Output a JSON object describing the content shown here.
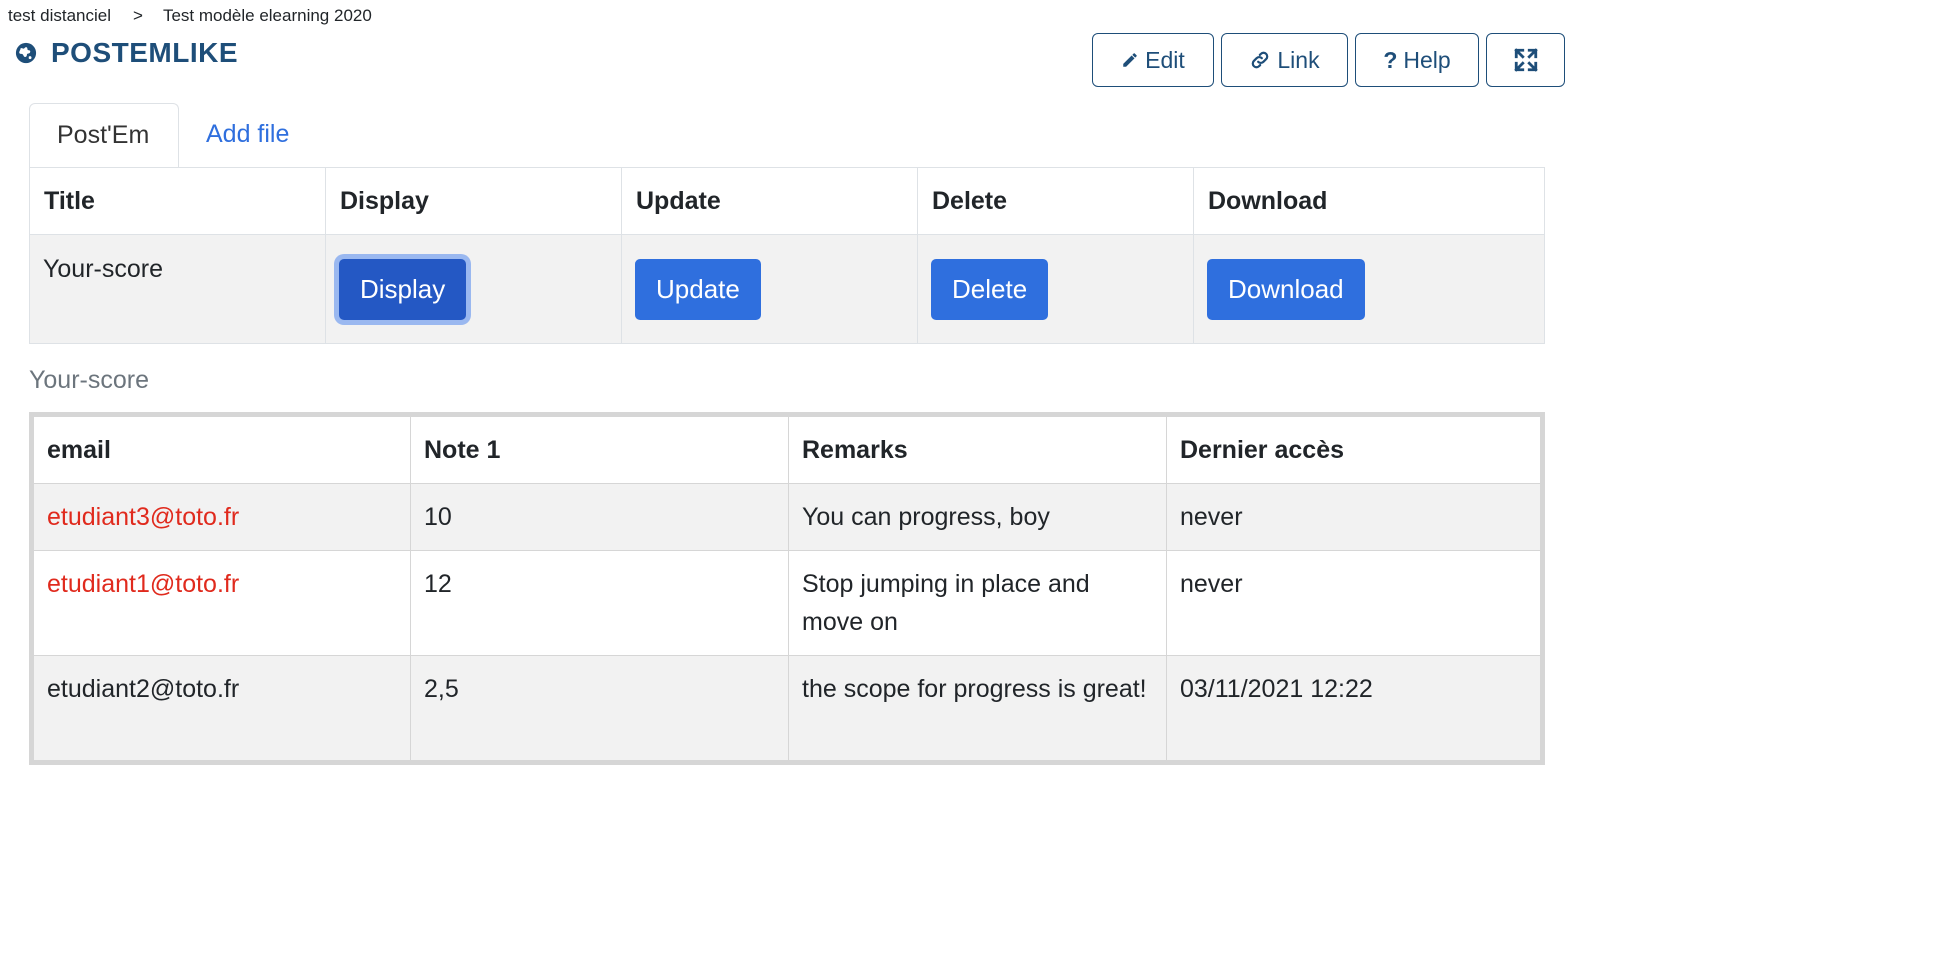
{
  "breadcrumb": {
    "items": [
      "test distanciel",
      "Test modèle elearning 2020"
    ],
    "separator": ">"
  },
  "header": {
    "title": "POSTEMLIKE",
    "icon": "globe-icon",
    "title_color": "#1e4e79"
  },
  "toolbar": {
    "edit_label": "Edit",
    "link_label": "Link",
    "help_label": "Help",
    "icons": [
      "pencil-icon",
      "link-icon",
      "question-icon",
      "expand-icon"
    ]
  },
  "tabs": [
    {
      "label": "Post'Em",
      "active": true
    },
    {
      "label": "Add file",
      "active": false
    }
  ],
  "files_table": {
    "headers": [
      "Title",
      "Display",
      "Update",
      "Delete",
      "Download"
    ],
    "rows": [
      {
        "title": "Your-score",
        "display_label": "Display",
        "update_label": "Update",
        "delete_label": "Delete",
        "download_label": "Download"
      }
    ]
  },
  "score_section": {
    "title": "Your-score",
    "headers": [
      "email",
      "Note 1",
      "Remarks",
      "Dernier accès"
    ],
    "rows": [
      {
        "email": "etudiant3@toto.fr",
        "note": "10",
        "remarks": "You can progress, boy",
        "last_access": "never",
        "highlight": true
      },
      {
        "email": "etudiant1@toto.fr",
        "note": "12",
        "remarks": "Stop jumping in place and move on",
        "last_access": "never",
        "highlight": true
      },
      {
        "email": "etudiant2@toto.fr",
        "note": "2,5",
        "remarks": "the scope for progress is great!",
        "last_access": "03/11/2021 12:22",
        "highlight": false
      }
    ]
  },
  "colors": {
    "primary": "#2f6fde",
    "primary_focused": "#2458c4",
    "highlight_email": "#e02a1d",
    "muted": "#6c757d"
  }
}
